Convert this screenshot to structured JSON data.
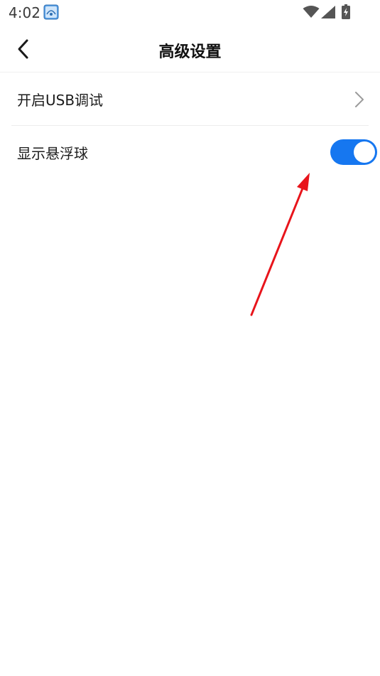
{
  "status_bar": {
    "time": "4:02",
    "app_icon": "app-notification-icon",
    "wifi_icon": "wifi-icon",
    "signal_icon": "cell-signal-icon",
    "battery_icon": "battery-charging-icon"
  },
  "header": {
    "back_icon": "chevron-left-icon",
    "title": "高级设置"
  },
  "settings": {
    "usb_debug": {
      "label": "开启USB调试",
      "icon": "chevron-right-icon"
    },
    "floating_ball": {
      "label": "显示悬浮球",
      "toggle_on": true
    }
  },
  "colors": {
    "accent": "#1677f0",
    "annotation": "#e8141b"
  }
}
